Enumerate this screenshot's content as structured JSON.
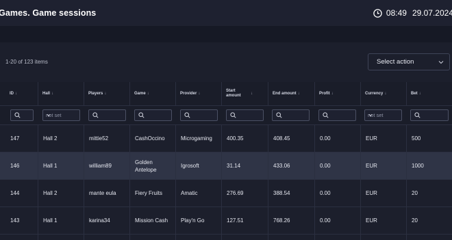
{
  "header": {
    "title": "Games. Game sessions",
    "time": "08:49",
    "date": "29.07.2024"
  },
  "toolbar": {
    "items_count": "1-20 of 123 items",
    "select_action": "Select action"
  },
  "table": {
    "columns": [
      "ID",
      "Hall",
      "Players",
      "Game",
      "Provider",
      "Start amount",
      "End amount",
      "Profit",
      "Currency",
      "Bet"
    ],
    "filters": {
      "hall": "not set",
      "currency": "not set"
    },
    "rows": [
      [
        "147",
        "Hall 2",
        "mittie52",
        "CashOccino",
        "Microgaming",
        "400.35",
        "408.45",
        "0.00",
        "EUR",
        "500"
      ],
      [
        "146",
        "Hall 1",
        "william89",
        "Golden Antelope",
        "Igrosoft",
        "31.14",
        "433.06",
        "0.00",
        "EUR",
        "1000"
      ],
      [
        "144",
        "Hall 2",
        "mante eula",
        "Fiery Fruits",
        "Amatic",
        "276.69",
        "388.54",
        "0.00",
        "EUR",
        "20"
      ],
      [
        "143",
        "Hall 1",
        "karina34",
        "Mission Cash",
        "Play'n Go",
        "127.51",
        "768.26",
        "0.00",
        "EUR",
        "20"
      ]
    ]
  },
  "colors": {
    "background": "#191c28",
    "topbar": "#1e2130",
    "selected_row": "#2f3446",
    "border": "#2b2f40"
  },
  "icons": {
    "clock": "clock-icon",
    "search": "search-icon",
    "chevron": "chevron-down-icon",
    "sort": "sort-arrow-icon"
  }
}
